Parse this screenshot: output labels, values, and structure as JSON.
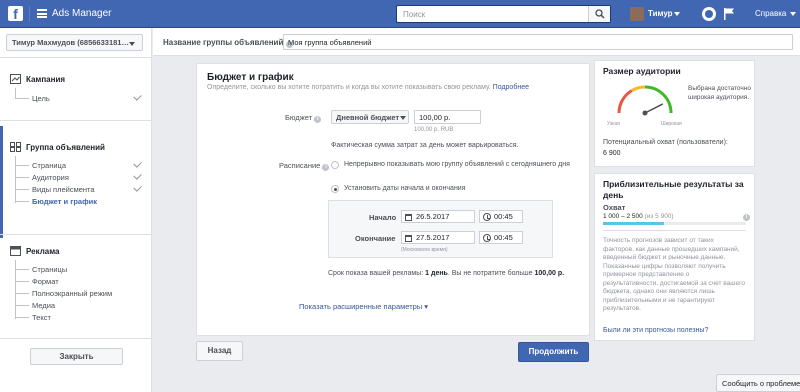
{
  "topbar": {
    "logo": "f",
    "app_title": "Ads Manager",
    "search_placeholder": "Поиск",
    "user_name": "Тимур",
    "help_label": "Справка"
  },
  "sidebar": {
    "account": "Тимур Махмудов (6856633181…",
    "campaign": {
      "title": "Кампания",
      "items": [
        {
          "label": "Цель",
          "done": true
        }
      ]
    },
    "adset": {
      "title": "Группа объявлений",
      "items": [
        {
          "label": "Страница",
          "done": true
        },
        {
          "label": "Аудитория",
          "done": true
        },
        {
          "label": "Виды плейсмента",
          "done": true
        },
        {
          "label": "Бюджет и график",
          "done": false,
          "active": true
        }
      ]
    },
    "ad": {
      "title": "Реклама",
      "items": [
        {
          "label": "Страницы"
        },
        {
          "label": "Формат"
        },
        {
          "label": "Полноэкранный режим"
        },
        {
          "label": "Медиа"
        },
        {
          "label": "Текст"
        }
      ]
    },
    "close_label": "Закрыть"
  },
  "adset_name": {
    "label": "Название группы объявлений",
    "value": "Моя группа объявлений"
  },
  "budget": {
    "title": "Бюджет и график",
    "description": "Определите, сколько вы хотите потратить и когда вы хотите показывать свою рекламу.",
    "learn_more": "Подробнее",
    "budget_label": "Бюджет",
    "budget_type": "Дневной бюджет",
    "amount": "100,00 р.",
    "amount_sub": "100,00 р. RUB",
    "note": "Фактическая сумма затрат за день может варьироваться.",
    "schedule_label": "Расписание",
    "option_continuous": "Непрерывно показывать мою группу объявлений с сегодняшнего дня",
    "option_dates": "Установить даты начала и окончания",
    "start_label": "Начало",
    "start_date": "26.5.2017",
    "start_time": "00:45",
    "end_label": "Окончание",
    "end_date": "27.5.2017",
    "end_time": "00:45",
    "timezone_note": "(Московское время)",
    "duration_prefix": "Срок показа вашей рекламы:",
    "duration_value": "1 день",
    "duration_mid": ". Вы не потратите больше",
    "duration_amount": "100,00 р.",
    "advanced_link": "Показать расширенные параметры ▾"
  },
  "footer": {
    "back_label": "Назад",
    "continue_label": "Продолжить"
  },
  "audience": {
    "title": "Размер аудитории",
    "gauge_low": "Узкая",
    "gauge_high": "Широкая",
    "gauge_level": 0.85,
    "description": "Выбрана достаточно широкая аудитория.",
    "reach_label": "Потенциальный охват (пользователи):",
    "reach_value": "6 900"
  },
  "results": {
    "title": "Приблизительные результаты за день",
    "subtitle": "Охват",
    "range": "1 000 – 2 500",
    "range_of": "(из 5 900)",
    "fill_fraction": 0.43,
    "description": "Точность прогнозов зависит от таких факторов, как данные прошедших кампаний, введенный бюджет и рыночные данные. Показанные цифры позволяют получить примерное представление о результативности, достигаемой за счет вашего бюджета, однако они являются лишь приблизительными и не гарантируют результатов.",
    "feedback_link": "Были ли эти прогнозы полезны?"
  },
  "report_problem": "Сообщить о проблеме",
  "colors": {
    "brand": "#4267b2",
    "gauge_red": "#e9573f",
    "gauge_yellow": "#f7b928",
    "gauge_green": "#42b72a",
    "results_bar": "#5ac4e4"
  }
}
